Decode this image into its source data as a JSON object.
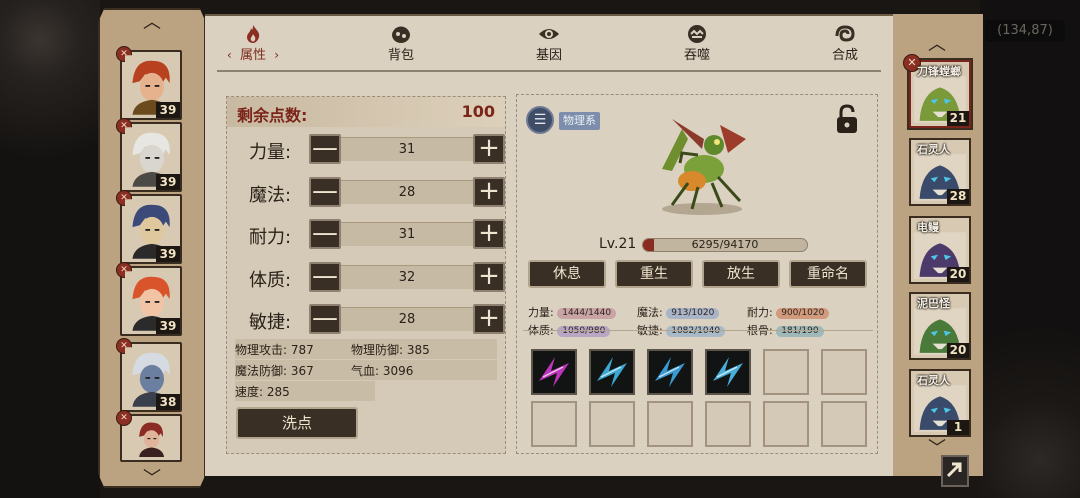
{
  "coord_text": "(134,87)",
  "left_chars": [
    {
      "level": "39",
      "hair": "#b8421f",
      "skin": "#e6b28e",
      "cloth": "#6b4a1e"
    },
    {
      "level": "39",
      "hair": "#e8e6e2",
      "skin": "#d9d6cf",
      "cloth": "#4c4a47"
    },
    {
      "level": "39",
      "hair": "#3c4a7a",
      "skin": "#e0c89e",
      "cloth": "#2a2a2a"
    },
    {
      "level": "39",
      "hair": "#d9542a",
      "skin": "#f0c4a4",
      "cloth": "#2b2b2b"
    },
    {
      "level": "38",
      "hair": "#d6dbe3",
      "skin": "#6b7fa0",
      "cloth": "#3a3f4c"
    },
    {
      "level": "",
      "hair": "#8c2b26",
      "skin": "#e0b49a",
      "cloth": "#3a2020"
    }
  ],
  "tabs": [
    "属性",
    "背包",
    "基因",
    "吞噬",
    "合成"
  ],
  "stats": {
    "remain_label": "剩余点数:",
    "remain_value": "100",
    "rows": [
      {
        "label": "力量:",
        "value": "31"
      },
      {
        "label": "魔法:",
        "value": "28"
      },
      {
        "label": "耐力:",
        "value": "31"
      },
      {
        "label": "体质:",
        "value": "32"
      },
      {
        "label": "敏捷:",
        "value": "28"
      }
    ],
    "derived": [
      {
        "a": "物理攻击: 787",
        "b": "物理防御: 385"
      },
      {
        "a": "魔法防御: 367",
        "b": "气血: 3096"
      },
      {
        "a": "速度: 285",
        "b": ""
      }
    ],
    "wash_label": "洗点",
    "minus_symbol": "—",
    "plus_symbol": "+"
  },
  "monster": {
    "type_label": "物理系",
    "type_icon": "list-icon",
    "level": "Lv.21",
    "xp_text": "6295/94170",
    "xp_fraction": 0.067,
    "actions": [
      "休息",
      "重生",
      "放生",
      "重命名"
    ],
    "attrs": [
      {
        "label": "力量:",
        "value": "1444/1440",
        "color": "#c9a4a4"
      },
      {
        "label": "魔法:",
        "value": "913/1020",
        "color": "#aab4c8"
      },
      {
        "label": "耐力:",
        "value": "900/1020",
        "color": "#d19a7c"
      },
      {
        "label": "体质:",
        "value": "1050/980",
        "color": "#b8a6c4"
      },
      {
        "label": "敏捷:",
        "value": "1082/1040",
        "color": "#a8bac8"
      },
      {
        "label": "根骨:",
        "value": "181/190",
        "color": "#9fb8b8"
      }
    ],
    "skills": [
      {
        "filled": true,
        "color": "#d03ad0"
      },
      {
        "filled": true,
        "color": "#3fb9e6"
      },
      {
        "filled": true,
        "color": "#3fa8e6"
      },
      {
        "filled": true,
        "color": "#4fc0ee"
      },
      {
        "filled": false
      },
      {
        "filled": false
      },
      {
        "filled": false
      },
      {
        "filled": false
      },
      {
        "filled": false
      },
      {
        "filled": false
      },
      {
        "filled": false
      },
      {
        "filled": false
      }
    ]
  },
  "pets": [
    {
      "name": "刀锋螳螂",
      "level": "21",
      "color": "#7a9a3a",
      "selected": true
    },
    {
      "name": "石灵人",
      "level": "28",
      "color": "#3a4a6a",
      "selected": false
    },
    {
      "name": "电鳗",
      "level": "20",
      "color": "#4b3a6a",
      "selected": false
    },
    {
      "name": "泥巴怪",
      "level": "20",
      "color": "#4a7a3a",
      "selected": false
    },
    {
      "name": "石灵人",
      "level": "1",
      "color": "#3a4a6a",
      "selected": false
    }
  ]
}
